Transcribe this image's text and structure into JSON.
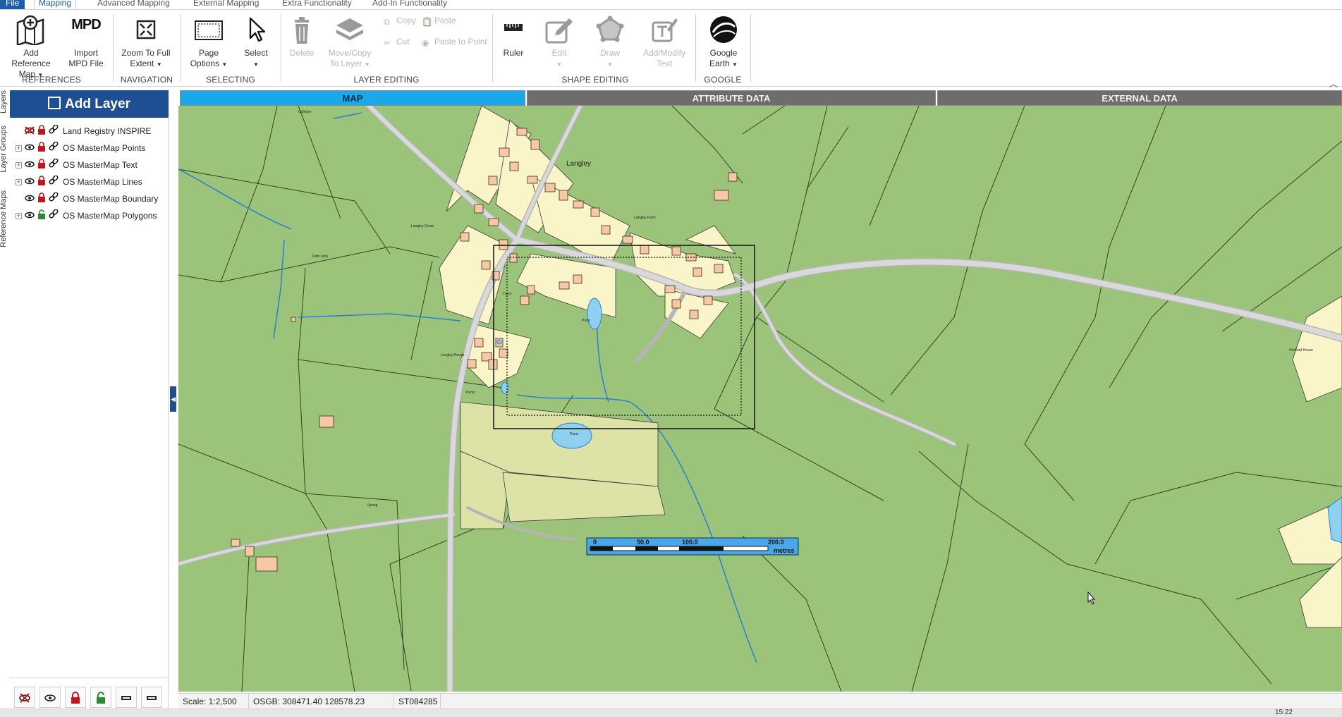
{
  "menu": {
    "tabs": [
      "File",
      "Mapping",
      "Advanced Mapping",
      "External Mapping",
      "Extra Functionality",
      "Add-In Functionality"
    ],
    "active": "Mapping"
  },
  "ribbon": {
    "add_reference_map": "Add Reference Map",
    "import_mpd_icon_text": "MPD",
    "import_mpd": "Import MPD File",
    "zoom_full_extent": "Zoom To Full Extent",
    "page_options": "Page Options",
    "select": "Select",
    "delete": "Delete",
    "move_copy": "Move/Copy To Layer",
    "copy": "Copy",
    "paste": "Paste",
    "cut": "Cut",
    "paste_to_point": "Paste to Point",
    "ruler": "Ruler",
    "edit": "Edit",
    "draw": "Draw",
    "add_modify_text": "Add/Modify Text",
    "google_earth": "Google Earth",
    "groups": {
      "references": "REFERENCES",
      "navigation": "NAVIGATION",
      "selecting": "SELECTING",
      "layer_editing": "LAYER EDITING",
      "shape_editing": "SHAPE EDITING",
      "google": "GOOGLE"
    }
  },
  "side_tabs": [
    "Layers",
    "Layer Groups",
    "Reference Maps"
  ],
  "layer_panel": {
    "add_layer": "Add Layer",
    "layers": [
      {
        "name": "Land Registry INSPIRE",
        "expandable": false,
        "visible": false,
        "locked": true
      },
      {
        "name": "OS MasterMap Points",
        "expandable": true,
        "visible": true,
        "locked": true
      },
      {
        "name": "OS MasterMap Text",
        "expandable": true,
        "visible": true,
        "locked": true
      },
      {
        "name": "OS MasterMap Lines",
        "expandable": true,
        "visible": true,
        "locked": true
      },
      {
        "name": "OS MasterMap Boundary",
        "expandable": false,
        "visible": true,
        "locked": true
      },
      {
        "name": "OS MasterMap Polygons",
        "expandable": true,
        "visible": true,
        "locked": false
      }
    ]
  },
  "map_tabs": [
    "MAP",
    "ATTRIBUTE DATA",
    "EXTERNAL DATA"
  ],
  "map": {
    "labels": {
      "langley": "Langley",
      "langley_cross": "Langley Cross",
      "langley_farm": "Langley Farm",
      "langley_house": "Langley House",
      "orchard_house": "Orchard House",
      "pond1": "Pond",
      "pond2": "Pond",
      "pond3": "Pond",
      "spring": "Spring",
      "colleton": "Colleton",
      "path_um": "Path (um)",
      "track": "Track"
    },
    "scale_bar": {
      "ticks": [
        "0",
        "50.0",
        "100.0",
        "200.0"
      ],
      "unit": "metres"
    },
    "colors": {
      "field": "#9bc47a",
      "garden": "#f9f5c8",
      "building": "#f6c9a4",
      "road": "#d3d3d3",
      "water": "#8fd0f0"
    }
  },
  "status": {
    "scale": "Scale: 1:2,500",
    "coords": "OSGB: 308471.40  128578.23",
    "grid_ref": "ST084285"
  },
  "taskbar": {
    "clock": "15:22"
  }
}
